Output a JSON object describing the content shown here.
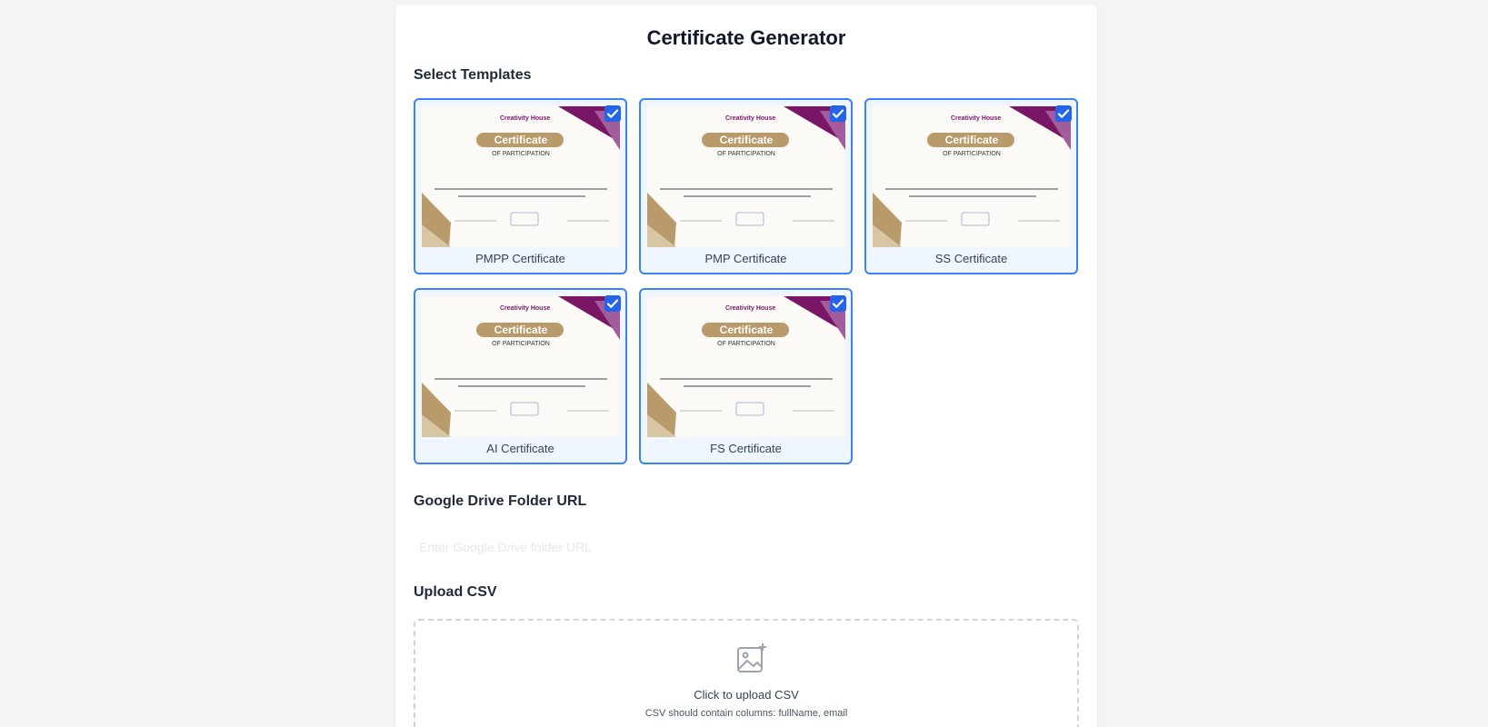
{
  "page": {
    "title": "Certificate Generator"
  },
  "templates": {
    "heading": "Select Templates",
    "items": [
      {
        "label": "PMPP Certificate",
        "selected": true
      },
      {
        "label": "PMP Certificate",
        "selected": true
      },
      {
        "label": "SS Certificate",
        "selected": true
      },
      {
        "label": "AI Certificate",
        "selected": true
      },
      {
        "label": "FS Certificate",
        "selected": true
      }
    ],
    "thumbnail": {
      "brand": "Creativity House",
      "banner": "Certificate",
      "subtitle": "OF PARTICIPATION"
    }
  },
  "drive": {
    "heading": "Google Drive Folder URL",
    "placeholder": "Enter Google Drive folder URL",
    "value": ""
  },
  "upload": {
    "heading": "Upload CSV",
    "label": "Click to upload CSV",
    "hint": "CSV should contain columns: fullName, email"
  },
  "colors": {
    "accent": "#3b82f6",
    "checkbox": "#2563eb",
    "selected_bg": "#eff6ff",
    "brand_purple": "#7a1666",
    "brand_gold": "#b99a6b"
  }
}
